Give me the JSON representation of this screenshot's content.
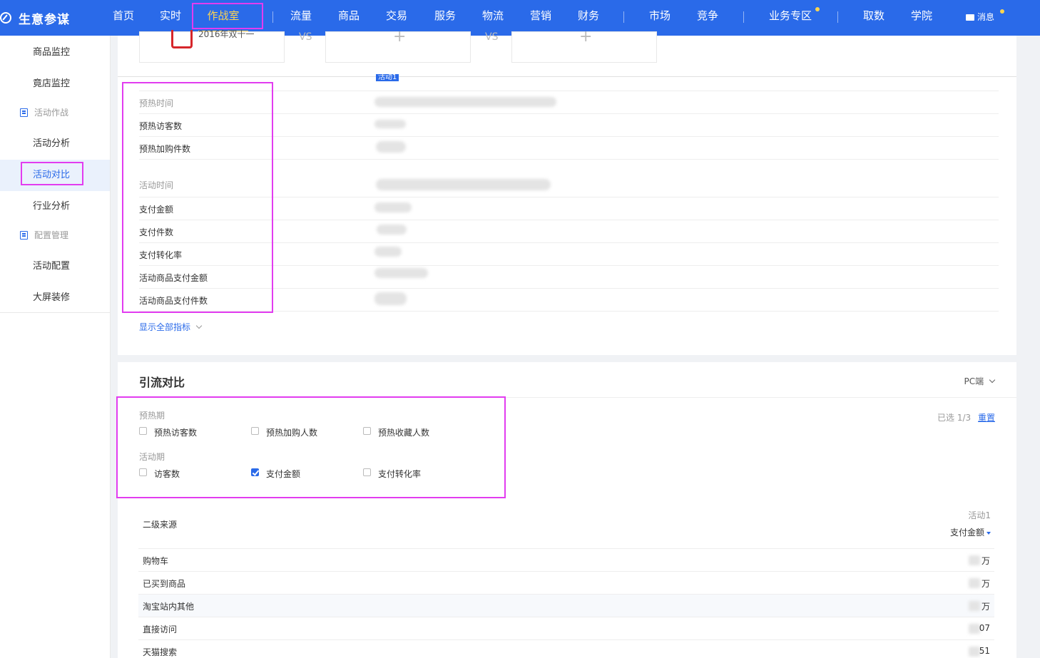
{
  "nav": {
    "brand": "生意参谋",
    "items": [
      "首页",
      "实时",
      "作战室",
      "流量",
      "商品",
      "交易",
      "服务",
      "物流",
      "营销",
      "财务",
      "市场",
      "竞争",
      "业务专区",
      "取数",
      "学院"
    ],
    "active": "作战室",
    "message": "消息"
  },
  "sidebar": {
    "items": [
      "商品监控",
      "竟店监控"
    ],
    "group1": "活动作战",
    "group1_items": [
      "活动分析",
      "活动对比",
      "行业分析"
    ],
    "group2": "配置管理",
    "group2_items": [
      "活动配置",
      "大屏装修"
    ],
    "active": "活动对比"
  },
  "compare": {
    "card1_label": "2016年双十一",
    "vs": "VS",
    "plus": "+",
    "tag": "活动1"
  },
  "metrics": {
    "preheat_time": "预热时间",
    "rows1": [
      "预热访客数",
      "预热加购件数"
    ],
    "activity_time": "活动时间",
    "rows2": [
      "支付金额",
      "支付件数",
      "支付转化率",
      "活动商品支付金额",
      "活动商品支付件数"
    ],
    "show_all": "显示全部指标"
  },
  "traffic": {
    "title": "引流对比",
    "device": "PC端",
    "preheat_label": "预热期",
    "preheat_options": [
      "预热访客数",
      "预热加购人数",
      "预热收藏人数"
    ],
    "activity_label": "活动期",
    "activity_options": [
      "访客数",
      "支付金额",
      "支付转化率"
    ],
    "selected": "已选 1/3",
    "reset": "重置",
    "col_source": "二级来源",
    "col_activity": "活动1",
    "col_metric": "支付金额",
    "rows": [
      {
        "name": "购物车",
        "value": "万"
      },
      {
        "name": "已买到商品",
        "value": "万"
      },
      {
        "name": "淘宝站内其他",
        "value": "万"
      },
      {
        "name": "直接访问",
        "value": "07"
      },
      {
        "name": "天猫搜索",
        "value": "51"
      }
    ]
  },
  "colors": {
    "primary": "#2a6ae9",
    "highlight": "#e23cf0",
    "active_nav": "#ffd54f"
  }
}
